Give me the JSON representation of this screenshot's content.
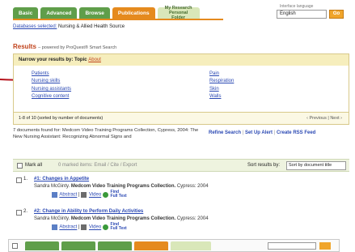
{
  "nav": {
    "tabs": [
      {
        "label": "Basic"
      },
      {
        "label": "Advanced"
      },
      {
        "label": "Browse"
      },
      {
        "label": "Publications"
      },
      {
        "label": "My Research\nPersonal Folder"
      }
    ]
  },
  "language": {
    "label": "Interface language",
    "value": "English",
    "go": "Go"
  },
  "database": {
    "link": "Databases selected:",
    "value": "Nursing & Allied Health Source"
  },
  "results": {
    "heading": "Results",
    "powered": "– powered by ProQuest® Smart Search"
  },
  "narrow": {
    "label": "Narrow your results by:",
    "topic": "Topic",
    "about": "About",
    "col1": [
      "Patients",
      "Nursing skills",
      "Nursing assistants",
      "Cognitive content"
    ],
    "col2": [
      "Pain",
      "Respiration",
      "Skin",
      "Walls"
    ],
    "footer": "1-8 of 10 (sorted by number of documents)",
    "prev": "‹ Previous | Next ›"
  },
  "found": {
    "text": "7 documents found for: Medcom Video Training Programs Collection, Cypress, 2004: The New Nursing Assistant: Recognizing Abnormal Signs and"
  },
  "actions": {
    "refine": "Refine Search",
    "alert": "Set Up Alert",
    "rss": "Create RSS Feed"
  },
  "toolbar": {
    "markall": "Mark all",
    "marked": "0 marked items: Email / Cite / Export",
    "sort_label": "Sort results by:",
    "sort_value": "Sort by document title"
  },
  "items": [
    {
      "num": "1.",
      "title": "#1: Changes in Appetite",
      "meta_author": "Sandra McGinty.",
      "meta_source": "Medcom Video Training Programs Collection.",
      "meta_place": "Cypress: 2004",
      "abstract": "Abstract",
      "video": "Video",
      "full": "Find\nFull Text"
    },
    {
      "num": "2.",
      "title": "#2: Change in Ability to Perform Daily Activities",
      "meta_author": "Sandra McGinty.",
      "meta_source": "Medcom Video Training Programs Collection.",
      "meta_place": "Cypress: 2004",
      "abstract": "Abstract",
      "video": "Video",
      "full": "Find\nFull Text"
    }
  ],
  "colors": {
    "tab": "#5f9e4a",
    "tab_active": "#e58a1e",
    "link": "#2a48b3",
    "heading": "#c0421b",
    "arrow": "#b5121b"
  }
}
